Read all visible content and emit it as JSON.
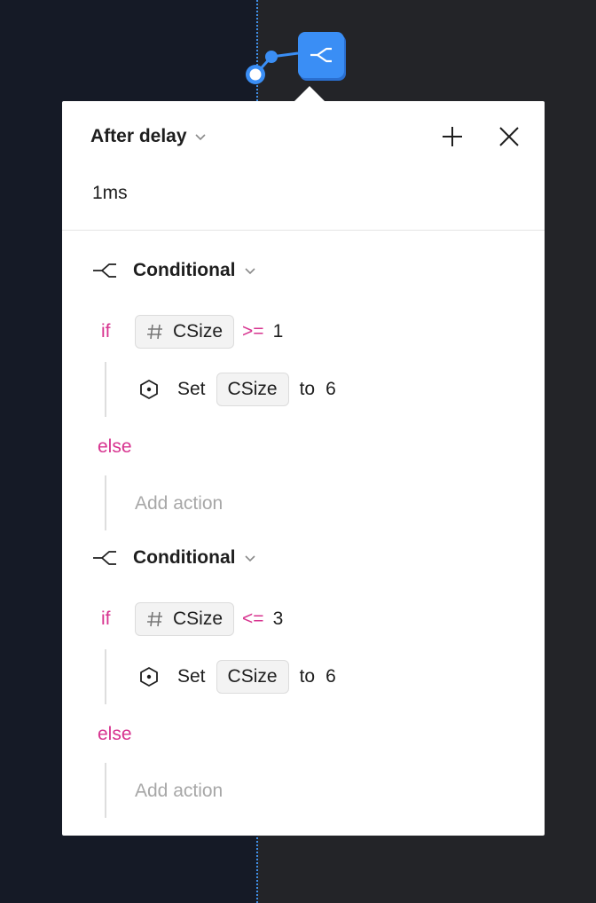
{
  "trigger": {
    "label": "After delay",
    "delay": "1ms"
  },
  "header_buttons": {
    "add": "plus-icon",
    "close": "close-icon"
  },
  "colors": {
    "keyword": "#d7338f",
    "node": "#3a8ef5",
    "canvas_left": "#151a26",
    "canvas_right": "#232428"
  },
  "conditionals": [
    {
      "label": "Conditional",
      "if_keyword": "if",
      "variable": "CSize",
      "operator": ">=",
      "value": "1",
      "action": {
        "verb": "Set",
        "variable": "CSize",
        "to_word": "to",
        "value": "6"
      },
      "else_keyword": "else",
      "else_placeholder": "Add action"
    },
    {
      "label": "Conditional",
      "if_keyword": "if",
      "variable": "CSize",
      "operator": "<=",
      "value": "3",
      "action": {
        "verb": "Set",
        "variable": "CSize",
        "to_word": "to",
        "value": "6"
      },
      "else_keyword": "else",
      "else_placeholder": "Add action"
    }
  ]
}
